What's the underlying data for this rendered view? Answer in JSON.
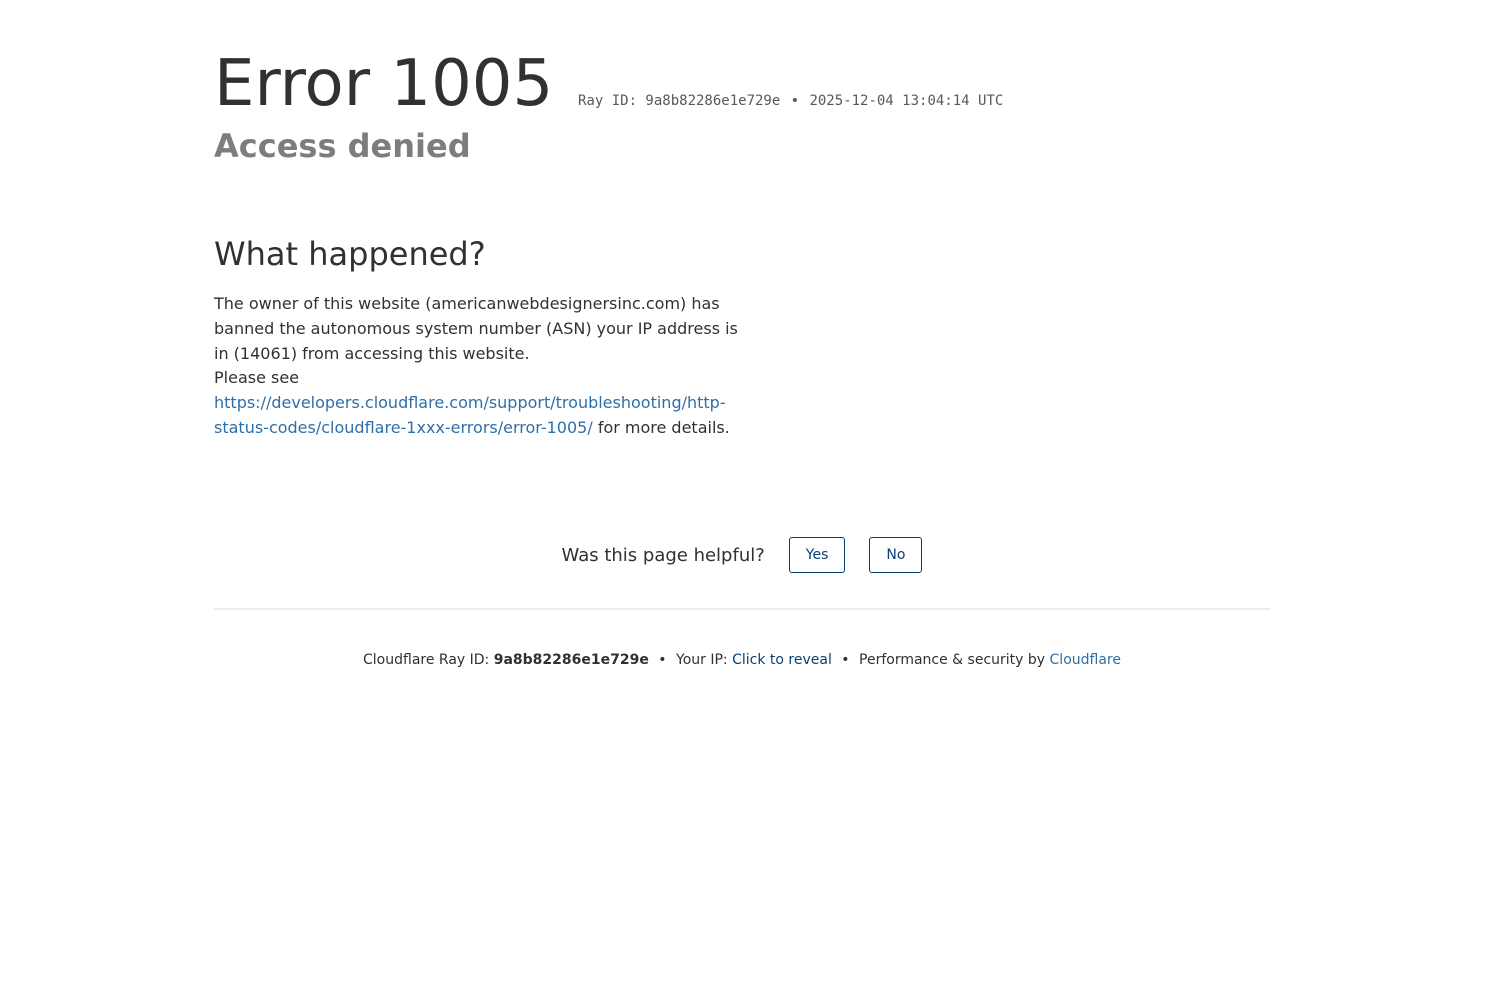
{
  "header": {
    "error_title": "Error 1005",
    "ray_id_text": "Ray ID: 9a8b82286e1e729e",
    "separator": "•",
    "timestamp": "2025-12-04 13:04:14 UTC",
    "subtitle": "Access denied"
  },
  "what_happened": {
    "title": "What happened?",
    "text_before_link": "The owner of this website (americanwebdesignersinc.com) has banned the autonomous system number (ASN) your IP address is in (14061) from accessing this website.",
    "please_see": "Please see",
    "link_text": "https://developers.cloudflare.com/support/troubleshooting/http-status-codes/cloudflare-1xxx-errors/error-1005/",
    "text_after_link": "for more details."
  },
  "feedback": {
    "question": "Was this page helpful?",
    "yes_label": "Yes",
    "no_label": "No"
  },
  "footer": {
    "ray_label": "Cloudflare Ray ID:",
    "ray_value": "9a8b82286e1e729e",
    "separator": "•",
    "ip_label": "Your IP:",
    "ip_reveal": "Click to reveal",
    "perf_label": "Performance & security by",
    "cloudflare_link": "Cloudflare"
  }
}
